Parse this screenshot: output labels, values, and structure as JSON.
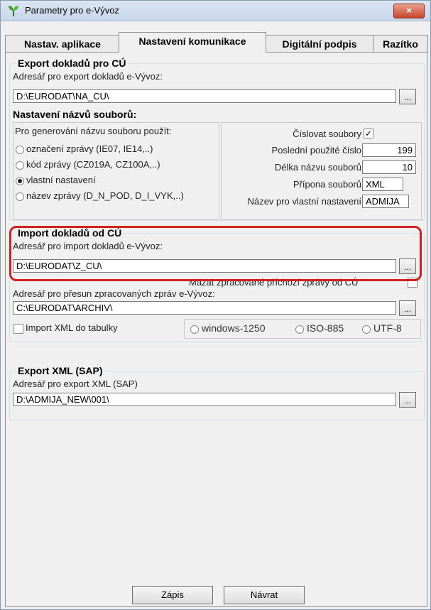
{
  "window": {
    "title": "Parametry pro e-Vývoz",
    "close_label": "×"
  },
  "tabs": [
    {
      "label": "Nastav. aplikace"
    },
    {
      "label": "Nastavení komunikace"
    },
    {
      "label": "Digitální podpis"
    },
    {
      "label": "Razítko"
    }
  ],
  "export_cu": {
    "title": "Export dokladů pro CÚ",
    "folder_label": "Adresář pro export dokladů e-Vývoz:",
    "folder_value": "D:\\EURODAT\\NA_CU\\",
    "browse_label": "...",
    "naming_title": "Nastavení názvů souborů:",
    "generate_label": "Pro generování názvu souboru použít:",
    "radios": [
      {
        "label": "označení zprávy (IE07, IE14,..)",
        "checked": false
      },
      {
        "label": "kód zprávy (CZ019A, CZ100A,..)",
        "checked": false
      },
      {
        "label": "vlastní nastavení",
        "checked": true
      },
      {
        "label": "název zprávy (D_N_POD, D_I_VYK,..)",
        "checked": false
      }
    ],
    "number_files_label": "Číslovat soubory",
    "number_files_checked": "✓",
    "last_number_label": "Poslední použité číslo",
    "last_number_value": "199",
    "name_length_label": "Délka názvu souborů",
    "name_length_value": "10",
    "extension_label": "Přípona souborů",
    "extension_value": "XML",
    "custom_name_label": "Název pro vlastní nastavení",
    "custom_name_value": "ADMIJA"
  },
  "import_cu": {
    "title": "Import dokladů od CÚ",
    "folder_label": "Adresář pro import dokladů e-Vývoz:",
    "folder_value": "D:\\EURODAT\\Z_CU\\",
    "browse_label": "...",
    "delete_label": "Mazat zpracované příchozí zprávy od CÚ",
    "move_label": "Adresář pro přesun zpracovaných zpráv e-Vývoz:",
    "move_value": "C:\\EURODAT\\ARCHIV\\",
    "import_xml_label": "Import XML do tabulky",
    "encodings": [
      {
        "label": "windows-1250"
      },
      {
        "label": "ISO-885"
      },
      {
        "label": "UTF-8"
      }
    ]
  },
  "export_sap": {
    "title": "Export XML (SAP)",
    "folder_label": "Adresář pro export XML (SAP)",
    "folder_value": "D:\\ADMIJA_NEW\\001\\",
    "browse_label": "..."
  },
  "buttons": {
    "save": "Zápis",
    "back": "Návrat"
  },
  "colors": {
    "highlight": "#d02020",
    "close": "#c8442a"
  }
}
